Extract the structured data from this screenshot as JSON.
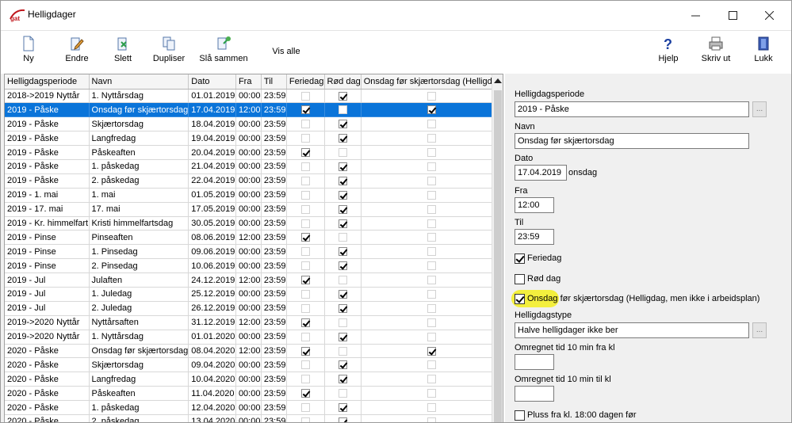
{
  "window": {
    "title": "Helligdager",
    "logo_text": "gat",
    "controls": [
      "minimize",
      "maximize",
      "close"
    ]
  },
  "toolbar": {
    "left": [
      {
        "label": "Ny",
        "icon": "new-document-icon"
      },
      {
        "label": "Endre",
        "icon": "edit-pencil-icon"
      },
      {
        "label": "Slett",
        "icon": "delete-icon"
      },
      {
        "label": "Dupliser",
        "icon": "duplicate-icon"
      },
      {
        "label": "Slå sammen",
        "icon": "merge-icon"
      },
      {
        "label": "Vis alle",
        "icon": ""
      }
    ],
    "right": [
      {
        "label": "Hjelp",
        "icon": "help-question-icon"
      },
      {
        "label": "Skriv ut",
        "icon": "printer-icon"
      },
      {
        "label": "Lukk",
        "icon": "exit-door-icon"
      }
    ]
  },
  "grid": {
    "columns": [
      "Helligdagsperiode",
      "Navn",
      "Dato",
      "Fra",
      "Til",
      "Feriedag",
      "Rød dag",
      "Onsdag før skjærtorsdag (Helligdag"
    ],
    "rows": [
      {
        "periode": "2018->2019 Nyttår",
        "navn": "1. Nyttårsdag",
        "dato": "01.01.2019",
        "fra": "00:00",
        "til": "23:59",
        "feriedag": false,
        "rod": true,
        "onsdag": false
      },
      {
        "periode": "2019 - Påske",
        "navn": "Onsdag før skjærtorsdag",
        "dato": "17.04.2019",
        "fra": "12:00",
        "til": "23:59",
        "feriedag": true,
        "rod": false,
        "onsdag": true,
        "selected": true
      },
      {
        "periode": "2019 - Påske",
        "navn": "Skjærtorsdag",
        "dato": "18.04.2019",
        "fra": "00:00",
        "til": "23:59",
        "feriedag": false,
        "rod": true,
        "onsdag": false
      },
      {
        "periode": "2019 - Påske",
        "navn": "Langfredag",
        "dato": "19.04.2019",
        "fra": "00:00",
        "til": "23:59",
        "feriedag": false,
        "rod": true,
        "onsdag": false
      },
      {
        "periode": "2019 - Påske",
        "navn": "Påskeaften",
        "dato": "20.04.2019",
        "fra": "00:00",
        "til": "23:59",
        "feriedag": true,
        "rod": false,
        "onsdag": false
      },
      {
        "periode": "2019 - Påske",
        "navn": "1. påskedag",
        "dato": "21.04.2019",
        "fra": "00:00",
        "til": "23:59",
        "feriedag": false,
        "rod": true,
        "onsdag": false
      },
      {
        "periode": "2019 - Påske",
        "navn": "2. påskedag",
        "dato": "22.04.2019",
        "fra": "00:00",
        "til": "23:59",
        "feriedag": false,
        "rod": true,
        "onsdag": false
      },
      {
        "periode": "2019 - 1. mai",
        "navn": "1. mai",
        "dato": "01.05.2019",
        "fra": "00:00",
        "til": "23:59",
        "feriedag": false,
        "rod": true,
        "onsdag": false
      },
      {
        "periode": "2019 - 17. mai",
        "navn": "17. mai",
        "dato": "17.05.2019",
        "fra": "00:00",
        "til": "23:59",
        "feriedag": false,
        "rod": true,
        "onsdag": false
      },
      {
        "periode": "2019 - Kr. himmelfart",
        "navn": "Kristi himmelfartsdag",
        "dato": "30.05.2019",
        "fra": "00:00",
        "til": "23:59",
        "feriedag": false,
        "rod": true,
        "onsdag": false
      },
      {
        "periode": "2019 - Pinse",
        "navn": "Pinseaften",
        "dato": "08.06.2019",
        "fra": "12:00",
        "til": "23:59",
        "feriedag": true,
        "rod": false,
        "onsdag": false
      },
      {
        "periode": "2019 - Pinse",
        "navn": "1. Pinsedag",
        "dato": "09.06.2019",
        "fra": "00:00",
        "til": "23:59",
        "feriedag": false,
        "rod": true,
        "onsdag": false
      },
      {
        "periode": "2019 - Pinse",
        "navn": "2. Pinsedag",
        "dato": "10.06.2019",
        "fra": "00:00",
        "til": "23:59",
        "feriedag": false,
        "rod": true,
        "onsdag": false
      },
      {
        "periode": "2019 - Jul",
        "navn": "Julaften",
        "dato": "24.12.2019",
        "fra": "12:00",
        "til": "23:59",
        "feriedag": true,
        "rod": false,
        "onsdag": false
      },
      {
        "periode": "2019 - Jul",
        "navn": "1. Juledag",
        "dato": "25.12.2019",
        "fra": "00:00",
        "til": "23:59",
        "feriedag": false,
        "rod": true,
        "onsdag": false
      },
      {
        "periode": "2019 - Jul",
        "navn": "2. Juledag",
        "dato": "26.12.2019",
        "fra": "00:00",
        "til": "23:59",
        "feriedag": false,
        "rod": true,
        "onsdag": false
      },
      {
        "periode": "2019->2020 Nyttår",
        "navn": "Nyttårsaften",
        "dato": "31.12.2019",
        "fra": "12:00",
        "til": "23:59",
        "feriedag": true,
        "rod": false,
        "onsdag": false
      },
      {
        "periode": "2019->2020 Nyttår",
        "navn": "1. Nyttårsdag",
        "dato": "01.01.2020",
        "fra": "00:00",
        "til": "23:59",
        "feriedag": false,
        "rod": true,
        "onsdag": false
      },
      {
        "periode": "2020 - Påske",
        "navn": "Onsdag før skjærtorsdag",
        "dato": "08.04.2020",
        "fra": "12:00",
        "til": "23:59",
        "feriedag": true,
        "rod": false,
        "onsdag": true
      },
      {
        "periode": "2020 - Påske",
        "navn": "Skjærtorsdag",
        "dato": "09.04.2020",
        "fra": "00:00",
        "til": "23:59",
        "feriedag": false,
        "rod": true,
        "onsdag": false
      },
      {
        "periode": "2020 - Påske",
        "navn": "Langfredag",
        "dato": "10.04.2020",
        "fra": "00:00",
        "til": "23:59",
        "feriedag": false,
        "rod": true,
        "onsdag": false
      },
      {
        "periode": "2020 - Påske",
        "navn": "Påskeaften",
        "dato": "11.04.2020",
        "fra": "00:00",
        "til": "23:59",
        "feriedag": true,
        "rod": false,
        "onsdag": false
      },
      {
        "periode": "2020 - Påske",
        "navn": "1. påskedag",
        "dato": "12.04.2020",
        "fra": "00:00",
        "til": "23:59",
        "feriedag": false,
        "rod": true,
        "onsdag": false
      },
      {
        "periode": "2020 - Påske",
        "navn": "2. påskedag",
        "dato": "13.04.2020",
        "fra": "00:00",
        "til": "23:59",
        "feriedag": false,
        "rod": true,
        "onsdag": false
      }
    ]
  },
  "form": {
    "periode_label": "Helligdagsperiode",
    "periode_value": "2019 - Påske",
    "navn_label": "Navn",
    "navn_value": "Onsdag før skjærtorsdag",
    "dato_label": "Dato",
    "dato_value": "17.04.2019",
    "dato_weekday": "onsdag",
    "fra_label": "Fra",
    "fra_value": "12:00",
    "til_label": "Til",
    "til_value": "23:59",
    "feriedag_label": "Feriedag",
    "feriedag_checked": true,
    "rod_label": "Rød dag",
    "rod_checked": false,
    "onsdag_label": "Onsdag før skjærtorsdag (Helligdag, men ikke i arbeidsplan)",
    "onsdag_checked": true,
    "type_label": "Helligdagstype",
    "type_value": "Halve helligdager ikke ber",
    "omregnet_fra_label": "Omregnet tid 10 min fra kl",
    "omregnet_fra_value": "",
    "omregnet_til_label": "Omregnet tid 10 min til kl",
    "omregnet_til_value": "",
    "pluss_label": "Pluss fra kl. 18:00 dagen før",
    "pluss_checked": false,
    "ellipsis": "..."
  },
  "colors": {
    "selection": "#0a74d9",
    "highlight": "#f3ee2a",
    "logo_red": "#c0161c"
  }
}
